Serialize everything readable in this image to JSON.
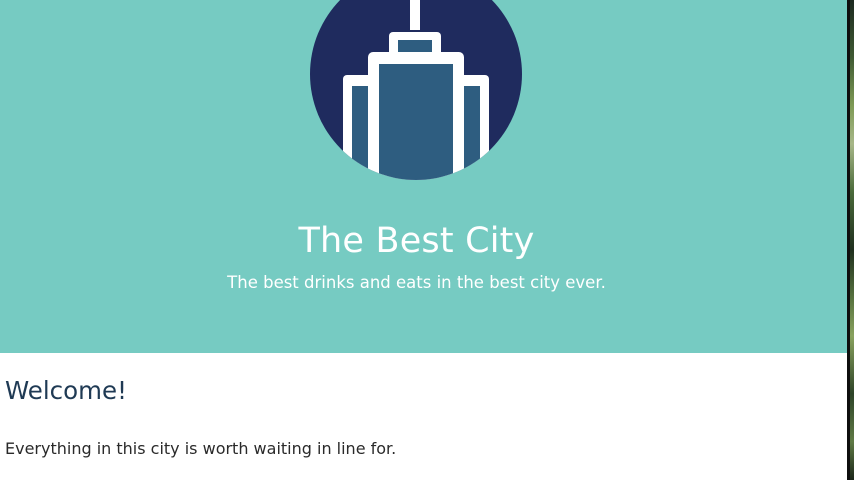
{
  "site": {
    "title": "The Best City",
    "tagline": "The best drinks and eats in the best city ever."
  },
  "logo": {
    "icon": "skyscraper-icon",
    "colors": {
      "circle": "#1f2b5e",
      "building": "#2e5d80",
      "outline": "#ffffff"
    }
  },
  "content": {
    "heading": "Welcome!",
    "body": "Everything in this city is worth waiting in line for."
  },
  "colors": {
    "hero_background": "#76cbc2",
    "heading_text": "#1f3a54",
    "body_text": "#2a2a2a",
    "page_background": "#ffffff"
  }
}
